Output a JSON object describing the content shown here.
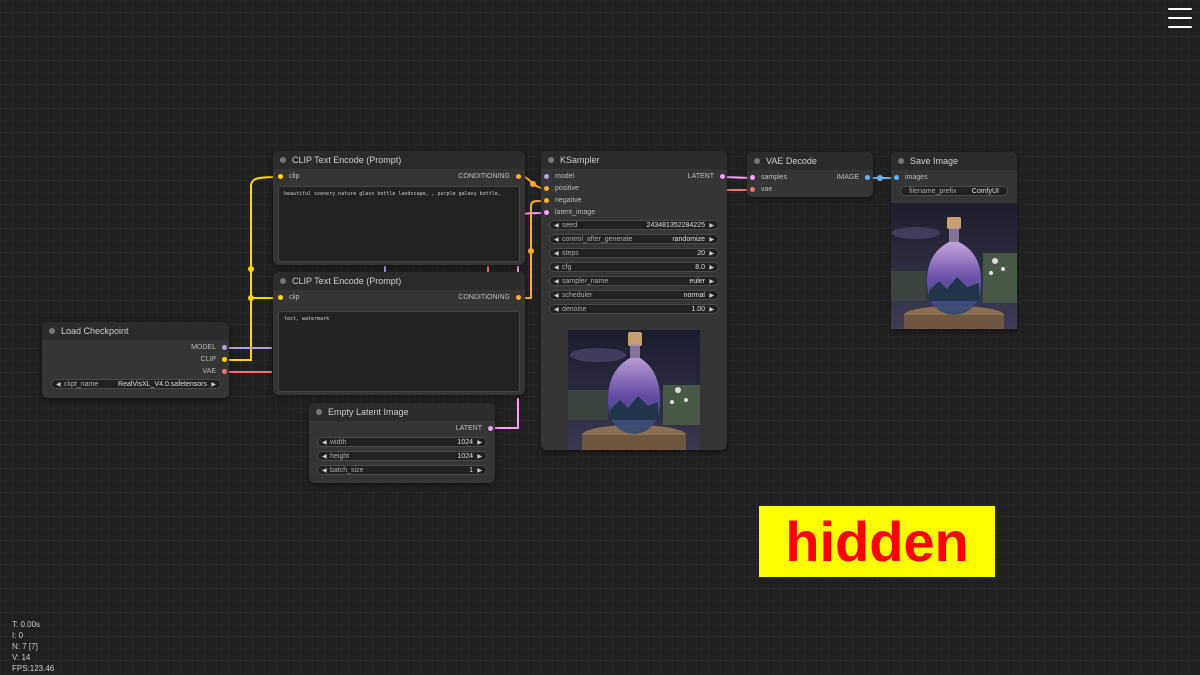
{
  "colors": {
    "model": "#b39ddb",
    "clip": "#ffd500",
    "vae": "#ff6e6e",
    "conditioning": "#ffa931",
    "latent": "#ff9cf9",
    "image": "#64b5f6"
  },
  "menu_icon": "hamburger-menu-icon",
  "nodes": {
    "clip_top": {
      "title": "CLIP Text Encode (Prompt)",
      "input_clip": "clip",
      "output": "CONDITIONING",
      "text": "beautiful scenery nature glass bottle landscape, , purple galaxy bottle,"
    },
    "clip_bottom": {
      "title": "CLIP Text Encode (Prompt)",
      "input_clip": "clip",
      "output": "CONDITIONING",
      "text": "text, watermark"
    },
    "checkpoint": {
      "title": "Load Checkpoint",
      "out_model": "MODEL",
      "out_clip": "CLIP",
      "out_vae": "VAE",
      "ckpt_label": "ckpt_name",
      "ckpt_value": "RealVisXL_V4.0.safetensors"
    },
    "latent": {
      "title": "Empty Latent Image",
      "output": "LATENT",
      "widgets": [
        {
          "label": "width",
          "value": "1024"
        },
        {
          "label": "height",
          "value": "1024"
        },
        {
          "label": "batch_size",
          "value": "1"
        }
      ]
    },
    "ksampler": {
      "title": "KSampler",
      "inputs": [
        "model",
        "positive",
        "negative",
        "latent_image"
      ],
      "output": "LATENT",
      "widgets": [
        {
          "label": "seed",
          "value": "243481352284225"
        },
        {
          "label": "control_after_generate",
          "value": "randomize"
        },
        {
          "label": "steps",
          "value": "20"
        },
        {
          "label": "cfg",
          "value": "8.0"
        },
        {
          "label": "sampler_name",
          "value": "euler"
        },
        {
          "label": "scheduler",
          "value": "normal"
        },
        {
          "label": "denoise",
          "value": "1.00"
        }
      ]
    },
    "vae_decode": {
      "title": "VAE Decode",
      "input_samples": "samples",
      "input_vae": "vae",
      "output": "IMAGE"
    },
    "save_image": {
      "title": "Save Image",
      "input_images": "images",
      "prefix_label": "filename_prefix",
      "prefix_value": "ComfyUI"
    }
  },
  "stats": {
    "t": "T: 0.00s",
    "i": "I: 0",
    "n": "N: 7 [7]",
    "v": "V: 14",
    "fps": "FPS:123.46"
  },
  "overlay_text": "hidden"
}
